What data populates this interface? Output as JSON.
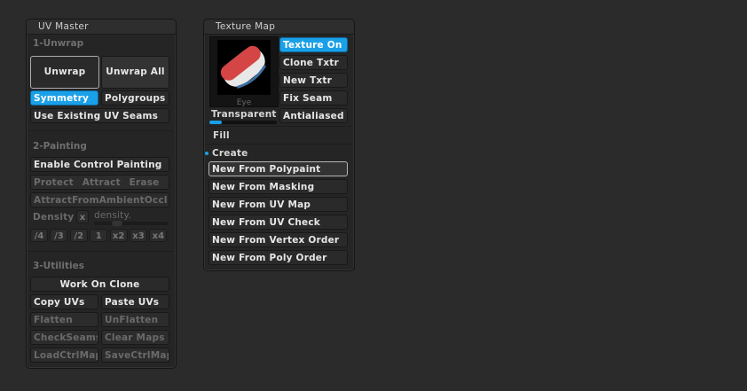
{
  "uv_master": {
    "title": "UV Master",
    "sections": {
      "unwrap": "1-Unwrap",
      "painting": "2-Painting",
      "utilities": "3-Utilities"
    },
    "buttons": {
      "unwrap": "Unwrap",
      "unwrap_all": "Unwrap All",
      "symmetry": "Symmetry",
      "polygroups": "Polygroups",
      "use_existing_uv_seams": "Use Existing UV Seams",
      "enable_control_painting": "Enable Control Painting",
      "protect": "Protect",
      "attract": "Attract",
      "erase": "Erase",
      "attract_from_ambient": "AttractFromAmbientOccl",
      "density": "Density",
      "density_x": "x",
      "density_slider_label": "density.",
      "work_on_clone": "Work On Clone",
      "copy_uvs": "Copy UVs",
      "paste_uvs": "Paste UVs",
      "flatten": "Flatten",
      "unflatten": "UnFlatten",
      "check_seams": "CheckSeams",
      "clear_maps": "Clear Maps",
      "load_ctrl_map": "LoadCtrlMap",
      "save_ctrl_map": "SaveCtrlMap"
    },
    "density_buttons": [
      "/4",
      "/3",
      "/2",
      "1",
      "x2",
      "x3",
      "x4"
    ]
  },
  "texture_map": {
    "title": "Texture Map",
    "thumbnail_label": "Eye",
    "buttons": {
      "texture_on": "Texture On",
      "clone_txtr": "Clone Txtr",
      "new_txtr": "New Txtr",
      "fix_seam": "Fix Seam",
      "transparent": "Transparent",
      "antialiased": "Antialiased",
      "fill": "Fill",
      "create": "Create",
      "new_from_polypaint": "New From Polypaint",
      "new_from_masking": "New From Masking",
      "new_from_uv_map": "New From UV Map",
      "new_from_uv_check": "New From UV Check",
      "new_from_vertex_order": "New From Vertex Order",
      "new_from_poly_order": "New From Poly Order"
    }
  },
  "colors": {
    "accent": "#1aa0e8",
    "panel_bg": "#252525",
    "canvas_bg": "#2b2b2b",
    "texture_red": "#d64545",
    "iris_blue": "#3e6f9e"
  }
}
